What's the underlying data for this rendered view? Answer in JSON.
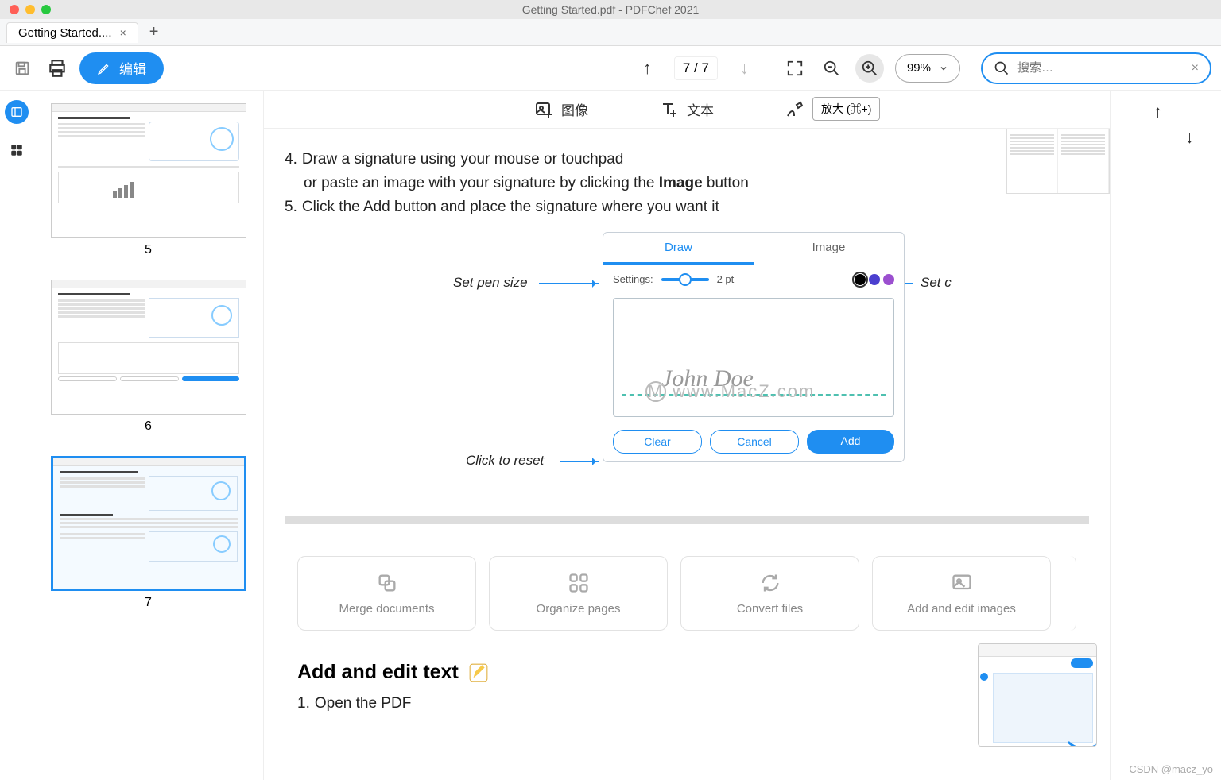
{
  "window": {
    "title": "Getting Started.pdf - PDFChef 2021"
  },
  "tab": {
    "label": "Getting Started....",
    "close": "×"
  },
  "toolbar": {
    "edit_label": "编辑",
    "page_current": "7",
    "page_total": "7",
    "page_sep": " / ",
    "zoom_pct": "99%",
    "search_placeholder": "搜索…",
    "tooltip_zoom_in": "放大 (⌘+)"
  },
  "edit_toolbar": {
    "image": "图像",
    "text": "文本",
    "signature": "签名"
  },
  "thumbs": [
    "5",
    "6",
    "7"
  ],
  "doc": {
    "step4_num": "4.",
    "step4_a": "Draw a signature using your mouse or touchpad",
    "step4_b_1": "or paste an image with your signature by clicking the ",
    "step4_b_bold": "Image",
    "step4_b_2": " button",
    "step5_num": "5.",
    "step5": "Click the Add button and place the signature where you want it",
    "annot_pen": "Set pen size",
    "annot_color": "Set c",
    "annot_reset": "Click to reset",
    "sig": {
      "tab_draw": "Draw",
      "tab_image": "Image",
      "settings": "Settings:",
      "pt": "2 pt",
      "sample": "John Doe",
      "clear": "Clear",
      "cancel": "Cancel",
      "add": "Add"
    },
    "watermark": "www.MacZ.com",
    "cards": {
      "merge": "Merge documents",
      "organize": "Organize pages",
      "convert": "Convert files",
      "images": "Add and edit images"
    },
    "section_h": "Add and edit text",
    "step1_num": "1.",
    "step1": "Open the PDF"
  },
  "footer_wm": "CSDN @macz_yo"
}
